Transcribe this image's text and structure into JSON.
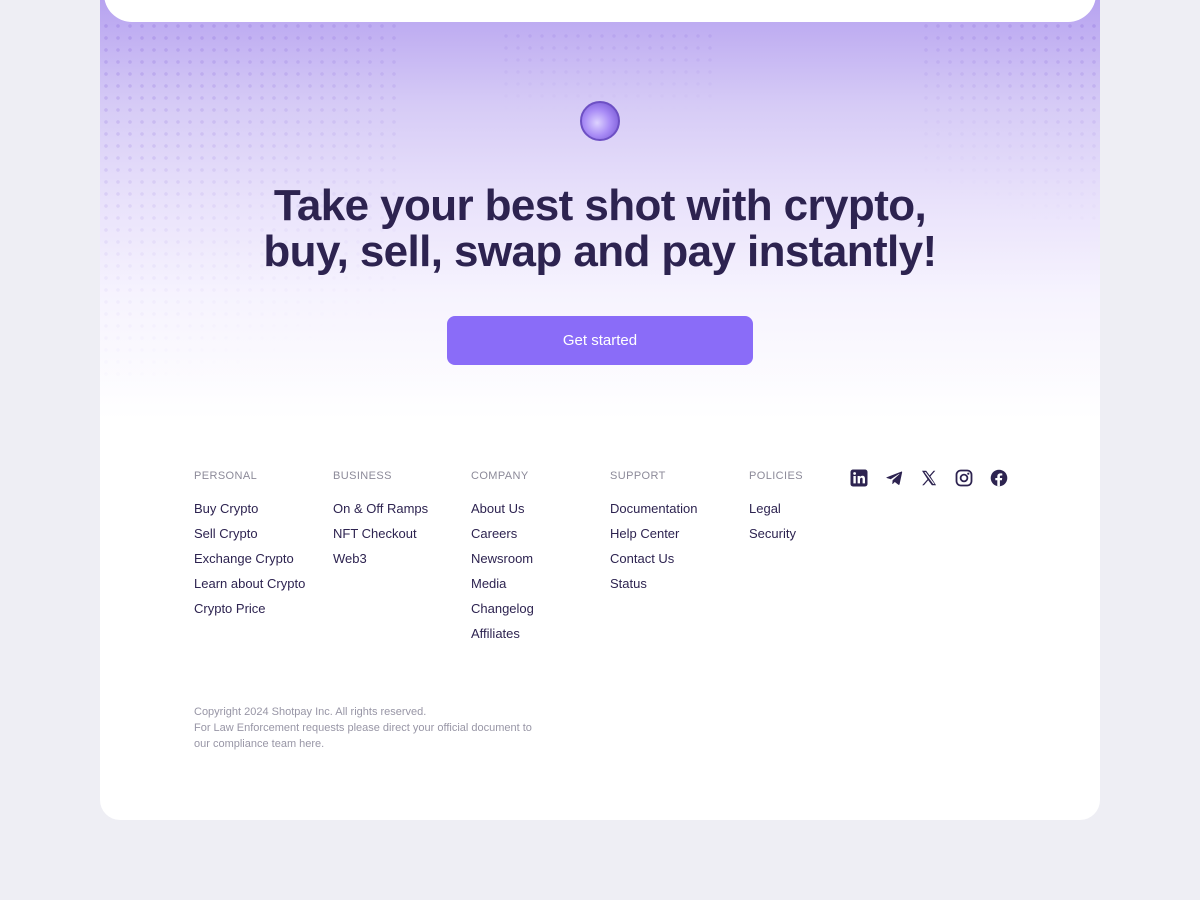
{
  "hero": {
    "headline_line1": "Take your best shot with crypto,",
    "headline_line2": "buy, sell, swap and pay instantly!",
    "cta_label": "Get started"
  },
  "footer": {
    "columns": [
      {
        "title": "PERSONAL",
        "links": [
          "Buy Crypto",
          "Sell Crypto",
          "Exchange Crypto",
          "Learn about Crypto",
          "Crypto Price"
        ]
      },
      {
        "title": "BUSINESS",
        "links": [
          "On & Off Ramps",
          "NFT Checkout",
          "Web3"
        ]
      },
      {
        "title": "COMPANY",
        "links": [
          "About Us",
          "Careers",
          "Newsroom",
          "Media",
          "Changelog",
          "Affiliates"
        ]
      },
      {
        "title": "SUPPORT",
        "links": [
          "Documentation",
          "Help Center",
          "Contact Us",
          "Status"
        ]
      },
      {
        "title": "POLICIES",
        "links": [
          "Legal",
          "Security"
        ]
      }
    ],
    "social_icons": [
      "linkedin-icon",
      "telegram-icon",
      "x-icon",
      "instagram-icon",
      "facebook-icon"
    ],
    "copyright_line1": "Copyright 2024 Shotpay Inc. All rights reserved.",
    "copyright_line2": "For Law Enforcement requests please direct your official document to our compliance team here."
  },
  "colors": {
    "accent": "#8a6cf8",
    "text_dark": "#2d2350",
    "muted": "#8c8a99",
    "page_bg": "#eeeef4"
  }
}
